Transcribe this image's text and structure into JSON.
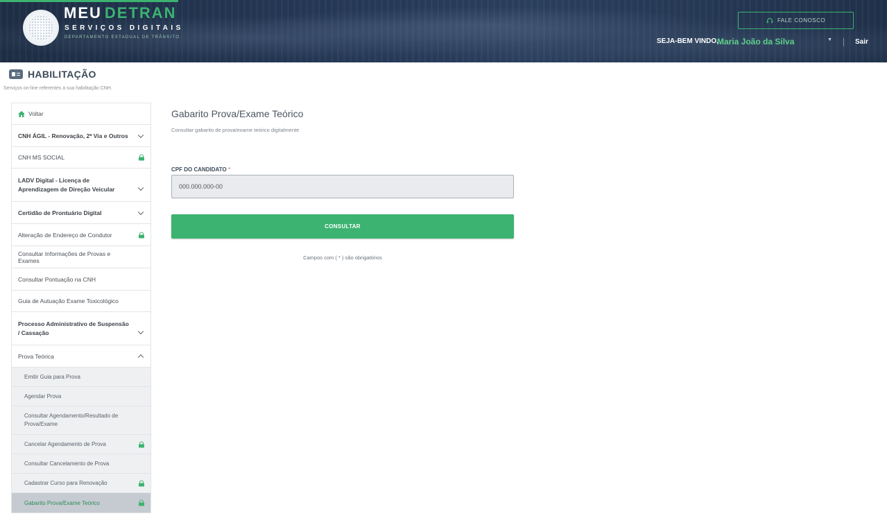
{
  "header": {
    "logo_title_a": "MEU",
    "logo_title_b": "DETRAN",
    "logo_subtitle": "SERVIÇOS DIGITAIS",
    "logo_subtitle2": "DEPARTAMENTO ESTADUAL DE TRÂNSITO",
    "contact_button": "FALE CONOSCO",
    "welcome_label": "SEJA-BEM VINDO,",
    "user_name": "Maria João da Silva",
    "logout": "Sair"
  },
  "section": {
    "title": "HABILITAÇÃO",
    "description": "Serviços on-line referentes a sua habilitação CNH."
  },
  "sidebar": {
    "items": [
      {
        "label": "Voltar"
      },
      {
        "label": "CNH ÁGIL - Renovação, 2ª Via e Outros"
      },
      {
        "label": "CNH MS SOCIAL"
      },
      {
        "label": "LADV Digital - Licença de Aprendizagem de Direção Veicular"
      },
      {
        "label": "Certidão de Prontuário Digital"
      },
      {
        "label": "Alteração de Endereço de Condutor"
      },
      {
        "label": "Consultar Informações de Provas e Exames"
      },
      {
        "label": "Consultar Pontuação na CNH"
      },
      {
        "label": "Guia de Autuação Exame Toxicológico"
      },
      {
        "label": "Processo Administrativo de Suspensão / Cassação"
      },
      {
        "label": "Prova Teórica"
      }
    ],
    "subitems": [
      {
        "label": "Emitir Guia para Prova"
      },
      {
        "label": "Agendar Prova"
      },
      {
        "label": "Consultar Agendamento/Resultado de Prova/Exame"
      },
      {
        "label": "Cancelar Agendamento de Prova"
      },
      {
        "label": "Consultar Cancelamento de Prova"
      },
      {
        "label": "Cadastrar Curso para Renovação"
      },
      {
        "label": "Gabarito Prova/Exame Teórico"
      }
    ]
  },
  "main": {
    "title": "Gabarito Prova/Exame Teórico",
    "description": "Consultar gabarito de prova/exame teórico digitalmente",
    "cpf_label": "CPF DO CANDIDATO",
    "cpf_required_mark": "*",
    "cpf_placeholder": "000.000.000-00",
    "submit": "CONSULTAR",
    "required_note": "Campos com ( * ) são obrigatórios"
  },
  "colors": {
    "accent": "#3cb371",
    "header_bg": "#243754",
    "sidebar_active_bg": "#c5cbd1"
  }
}
